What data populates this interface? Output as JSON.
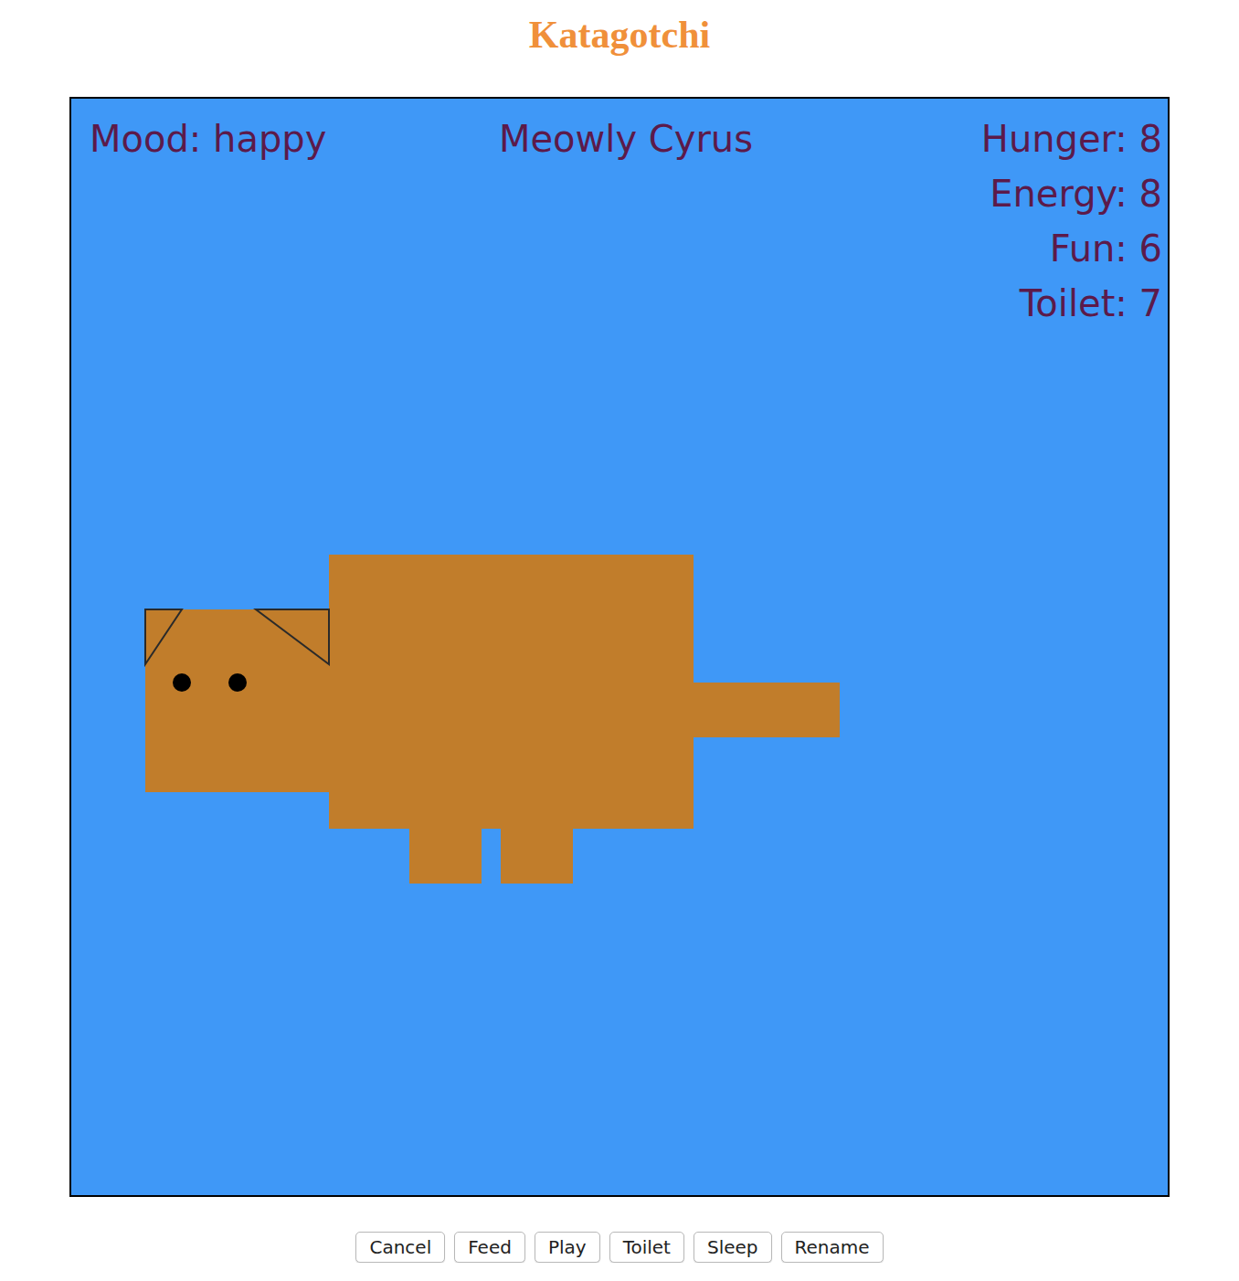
{
  "title": "Katagotchi",
  "mood": "Mood: happy",
  "pet_name": "Meowly Cyrus",
  "stats": [
    "Hunger: 8",
    "Energy: 8",
    "Fun: 6",
    "Toilet: 7"
  ],
  "buttons": [
    "Cancel",
    "Feed",
    "Play",
    "Toilet",
    "Sleep",
    "Rename"
  ]
}
